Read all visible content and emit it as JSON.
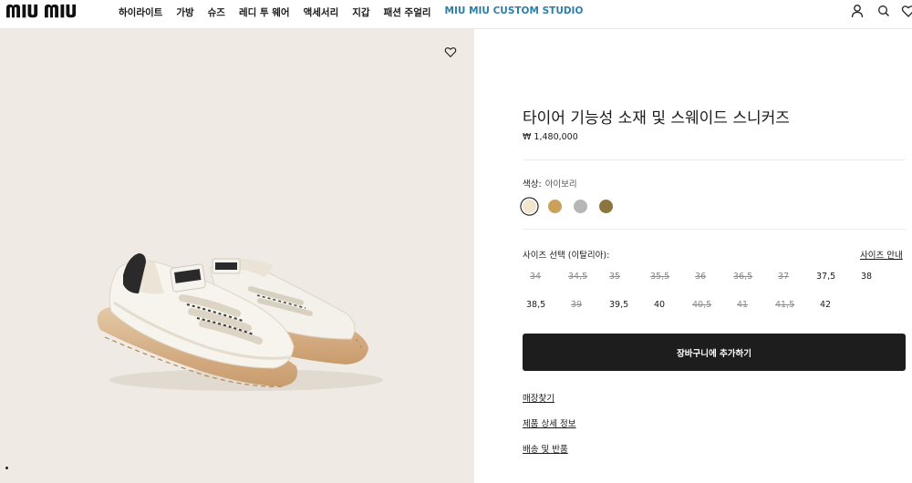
{
  "header": {
    "logo": "MIU MIU",
    "nav": [
      "하이라이트",
      "가방",
      "슈즈",
      "레디 투 웨어",
      "액세서리",
      "지갑",
      "패션 주얼리",
      "MIU MIU CUSTOM STUDIO"
    ],
    "icons": [
      "account-icon",
      "search-icon",
      "wishlist-icon"
    ]
  },
  "product": {
    "title": "타이어 기능성 소재 및 스웨이드 스니커즈",
    "price": "₩ 1,480,000",
    "color_label": "색상:",
    "color_value": "아이보리",
    "swatches": [
      "#f3e6cf",
      "#c9a15a",
      "#b8b6b4",
      "#8c7640"
    ],
    "selected_swatch": 0,
    "size_label": "사이즈 선택 (이탈리아):",
    "size_guide": "사이즈 안내",
    "sizes_row1": [
      {
        "v": "34",
        "available": false
      },
      {
        "v": "34,5",
        "available": false
      },
      {
        "v": "35",
        "available": false
      },
      {
        "v": "35,5",
        "available": false
      },
      {
        "v": "36",
        "available": false
      },
      {
        "v": "36,5",
        "available": false
      },
      {
        "v": "37",
        "available": false
      },
      {
        "v": "37,5",
        "available": true
      },
      {
        "v": "38",
        "available": true
      }
    ],
    "sizes_row2": [
      {
        "v": "38,5",
        "available": true
      },
      {
        "v": "39",
        "available": false
      },
      {
        "v": "39,5",
        "available": true
      },
      {
        "v": "40",
        "available": true
      },
      {
        "v": "40,5",
        "available": false
      },
      {
        "v": "41",
        "available": false
      },
      {
        "v": "41,5",
        "available": false
      },
      {
        "v": "42",
        "available": true
      }
    ],
    "add_to_cart": "장바구니에 추가하기",
    "links": [
      "매장찾기",
      "제품 상세 정보",
      "배송 및 반품"
    ]
  },
  "colors": {
    "hero_bg": "#efebe4",
    "studio_link": "#2d7fa8",
    "cart_bg": "#1d1d1d"
  }
}
